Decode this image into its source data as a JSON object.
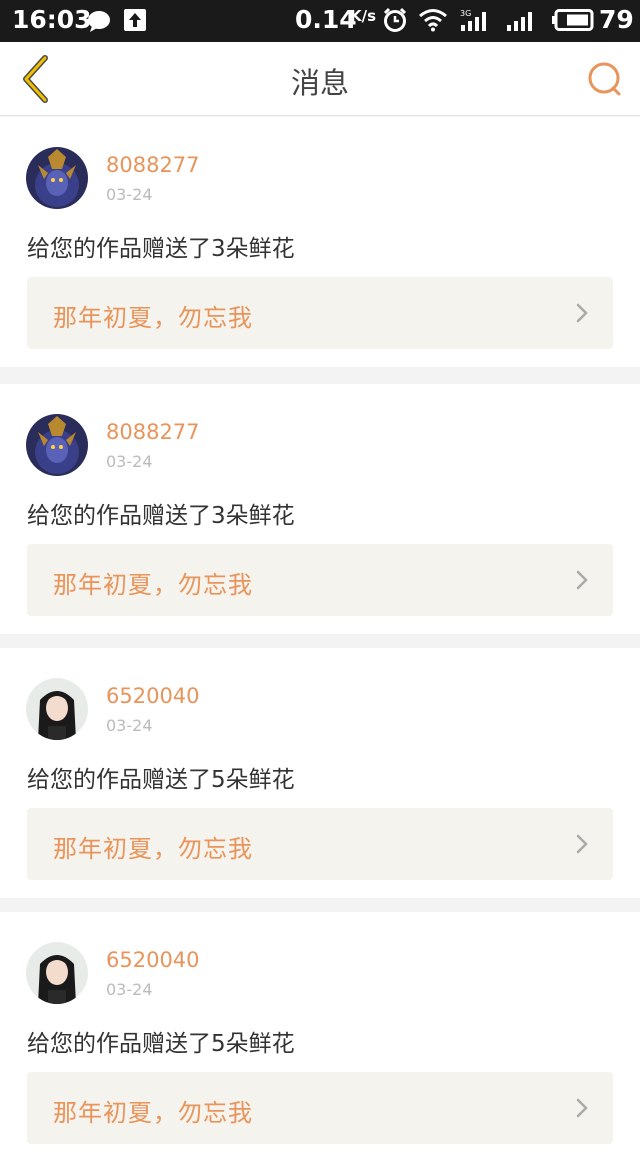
{
  "status_bar": {
    "time": "16:03",
    "network_speed": "0.14",
    "network_speed_unit": "K/s",
    "network_type": "3G",
    "battery_level": "79",
    "icons": [
      "chat-bubble-icon",
      "upload-icon",
      "alarm-icon",
      "wifi-icon",
      "signal-3g-icon",
      "signal-icon",
      "battery-icon"
    ]
  },
  "header": {
    "title": "消息",
    "back_icon": "chevron-left-icon",
    "search_icon": "search-icon",
    "accent_color": "#e8945a"
  },
  "messages": [
    {
      "username": "8088277",
      "date": "03-24",
      "text": "给您的作品赠送了3朵鲜花",
      "work_title": "那年初夏，勿忘我",
      "avatar": "warrior-avatar"
    },
    {
      "username": "8088277",
      "date": "03-24",
      "text": "给您的作品赠送了3朵鲜花",
      "work_title": "那年初夏，勿忘我",
      "avatar": "warrior-avatar"
    },
    {
      "username": "6520040",
      "date": "03-24",
      "text": "给您的作品赠送了5朵鲜花",
      "work_title": "那年初夏，勿忘我",
      "avatar": "girl-avatar"
    },
    {
      "username": "6520040",
      "date": "03-24",
      "text": "给您的作品赠送了5朵鲜花",
      "work_title": "那年初夏，勿忘我",
      "avatar": "girl-avatar"
    }
  ]
}
